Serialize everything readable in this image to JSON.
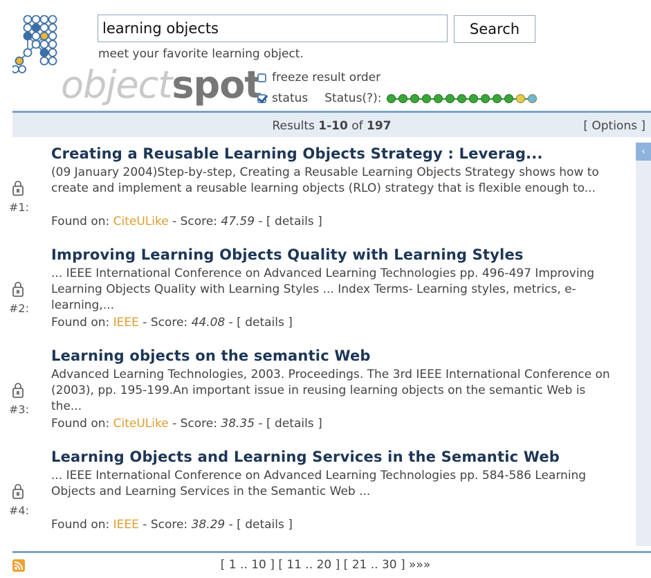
{
  "search": {
    "value": "learning objects",
    "button_label": "Search"
  },
  "tagline": "meet your favorite learning object.",
  "logo": {
    "word_light": "object",
    "word_bold": "spot"
  },
  "options": {
    "freeze_label": "freeze result order",
    "freeze_checked": false,
    "status_label": "status",
    "status_checked": true,
    "status_text": "Status(?):"
  },
  "status_indicators": [
    "done",
    "done",
    "done",
    "done",
    "done",
    "done",
    "done",
    "done",
    "done",
    "done",
    "done",
    "pending",
    "active"
  ],
  "colors": {
    "accent": "#7ea2c8",
    "title": "#1d3656",
    "source": "#e09c2c",
    "done": "#3aa63a",
    "pending": "#e8c94a",
    "active": "#6fb6d6"
  },
  "results_bar": {
    "prefix": "Results ",
    "range": "1-10",
    "of_text": " of ",
    "total": "197",
    "options_label": "[ Options ]"
  },
  "results": [
    {
      "num": "#1:",
      "title": "Creating a Reusable Learning Objects Strategy : Leverag...",
      "snippet": "(09 January 2004)Step-by-step, Creating a Reusable Learning Objects Strategy shows how to create and implement a reusable learning objects (RLO) strategy that is flexible enough to...",
      "found_label": "Found on: ",
      "source": "CiteULike",
      "score_label": " - Score: ",
      "score": "47.59",
      "details": " - [ details ]"
    },
    {
      "num": "#2:",
      "title": "Improving Learning Objects Quality with Learning Styles",
      "snippet": "... IEEE International Conference on Advanced Learning Technologies pp. 496-497 Improving Learning Objects Quality with Learning Styles ... Index Terms- Learning styles, metrics, e-learning,...",
      "found_label": "Found on: ",
      "source": "IEEE",
      "score_label": " - Score: ",
      "score": "44.08",
      "details": " - [ details ]"
    },
    {
      "num": "#3:",
      "title": "Learning objects on the semantic Web",
      "snippet": "Advanced Learning Technologies, 2003. Proceedings. The 3rd IEEE International Conference on (2003), pp. 195-199.An important issue in reusing learning objects on the semantic Web is the...",
      "found_label": "Found on: ",
      "source": "CiteULike",
      "score_label": " - Score: ",
      "score": "38.35",
      "details": " - [ details ]"
    },
    {
      "num": "#4:",
      "title": "Learning Objects and Learning Services in the Semantic Web",
      "snippet": "... IEEE International Conference on Advanced Learning Technologies pp. 584-586 Learning Objects and Learning Services in the Semantic Web ...",
      "found_label": "Found on: ",
      "source": "IEEE",
      "score_label": " - Score: ",
      "score": "38.29",
      "details": " - [ details ]"
    }
  ],
  "pager": {
    "pages": [
      "[ 1 .. 10 ]",
      "[ 11 .. 20 ]",
      "[ 21 .. 30 ]"
    ],
    "next": "»»»"
  },
  "icons": {
    "result_icon": "lock-doc-icon",
    "rss": "rss-icon",
    "collapse": "chevron-left-icon"
  }
}
